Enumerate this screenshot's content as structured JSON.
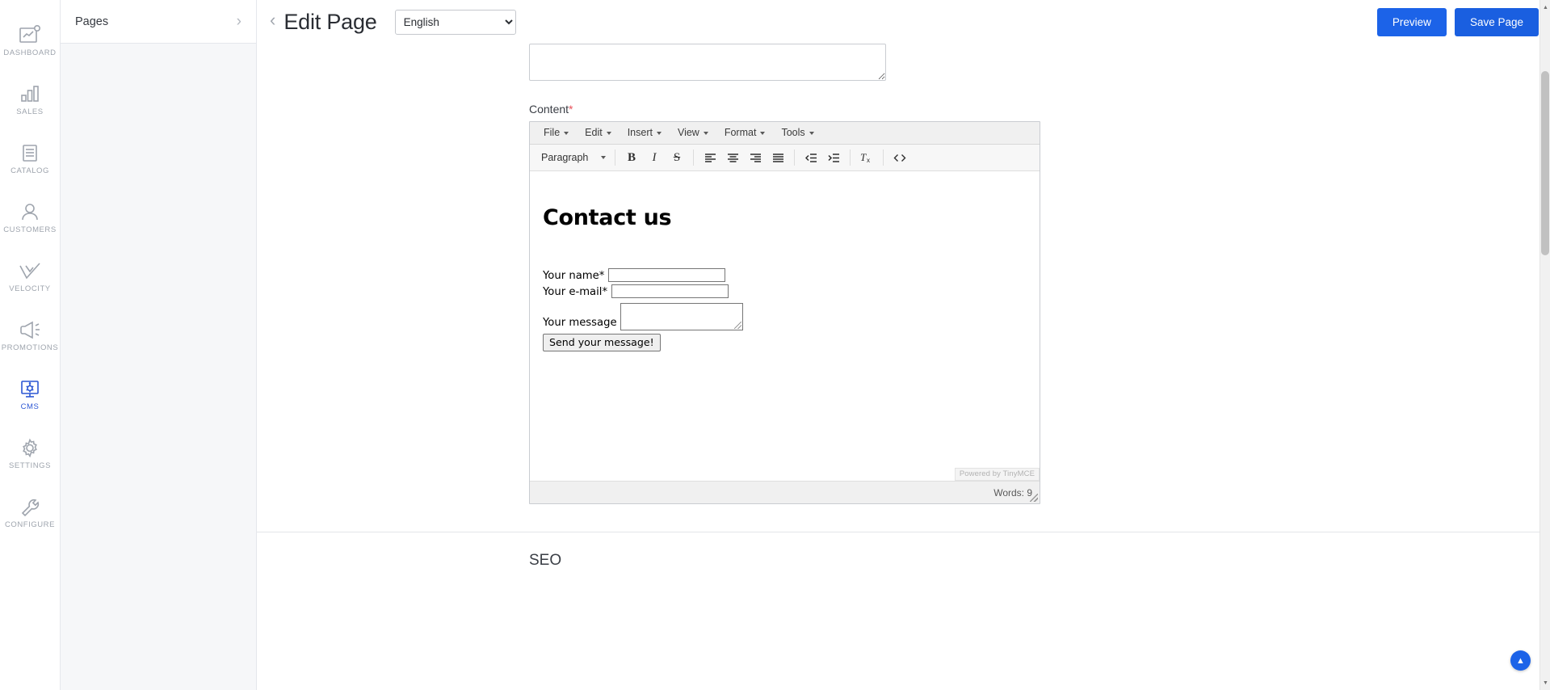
{
  "sidebar": {
    "items": [
      {
        "label": "DASHBOARD",
        "icon": "dashboard-icon",
        "active": false
      },
      {
        "label": "SALES",
        "icon": "bar-chart-icon",
        "active": false
      },
      {
        "label": "CATALOG",
        "icon": "catalog-lines-icon",
        "active": false
      },
      {
        "label": "CUSTOMERS",
        "icon": "person-icon",
        "active": false
      },
      {
        "label": "VELOCITY",
        "icon": "double-check-icon",
        "active": false
      },
      {
        "label": "PROMOTIONS",
        "icon": "megaphone-icon",
        "active": false
      },
      {
        "label": "CMS",
        "icon": "cms-monitor-gear-icon",
        "active": true
      },
      {
        "label": "SETTINGS",
        "icon": "gear-icon",
        "active": false
      },
      {
        "label": "CONFIGURE",
        "icon": "wrench-icon",
        "active": false
      }
    ]
  },
  "pages_panel": {
    "title": "Pages",
    "chevron": "›"
  },
  "topbar": {
    "back_arrow": "‹",
    "title": "Edit Page",
    "language": {
      "selected": "English",
      "options": [
        "English"
      ]
    },
    "preview_label": "Preview",
    "save_label": "Save Page"
  },
  "form": {
    "content_label": "Content",
    "required_mark": "*"
  },
  "editor": {
    "menubar": [
      {
        "label": "File"
      },
      {
        "label": "Edit"
      },
      {
        "label": "Insert"
      },
      {
        "label": "View"
      },
      {
        "label": "Format"
      },
      {
        "label": "Tools"
      }
    ],
    "format_select": "Paragraph",
    "toolbar": [
      {
        "name": "bold-icon",
        "glyph": "B"
      },
      {
        "name": "italic-icon",
        "glyph": "I"
      },
      {
        "name": "strikethrough-icon",
        "glyph": "S"
      },
      {
        "name": "align-left-icon",
        "glyph": ""
      },
      {
        "name": "align-center-icon",
        "glyph": ""
      },
      {
        "name": "align-right-icon",
        "glyph": ""
      },
      {
        "name": "align-justify-icon",
        "glyph": ""
      },
      {
        "name": "outdent-icon",
        "glyph": ""
      },
      {
        "name": "indent-icon",
        "glyph": ""
      },
      {
        "name": "clear-formatting-icon",
        "glyph": ""
      },
      {
        "name": "source-code-icon",
        "glyph": "<>"
      }
    ],
    "body": {
      "heading": "Contact us",
      "fields": [
        {
          "label": "Your name*",
          "value": "",
          "type": "text"
        },
        {
          "label": "Your e-mail*",
          "value": "",
          "type": "text"
        },
        {
          "label": "Your message",
          "value": "",
          "type": "textarea"
        }
      ],
      "submit_label": "Send your message!"
    },
    "branding": "Powered by TinyMCE",
    "status_words": "Words: 9"
  },
  "seo": {
    "title": "SEO"
  },
  "fab": {
    "label": "▲",
    "name": "scroll-to-top-button"
  },
  "colors": {
    "accent": "#1c63e8",
    "active_nav": "#2c57d4",
    "required": "#e8515a",
    "muted": "#9ea4ad"
  }
}
